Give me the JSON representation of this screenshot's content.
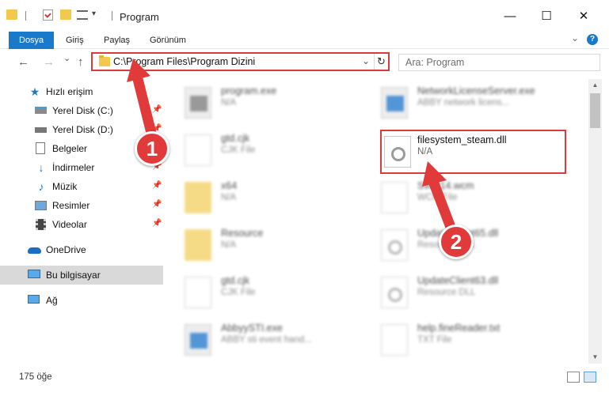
{
  "window": {
    "title": "Program",
    "minimize_glyph": "—",
    "maximize_glyph": "☐",
    "close_glyph": "✕"
  },
  "ribbon": {
    "tabs": [
      {
        "label": "Dosya"
      },
      {
        "label": "Giriş"
      },
      {
        "label": "Paylaş"
      },
      {
        "label": "Görünüm"
      }
    ],
    "expand_glyph": "⌄",
    "help_glyph": "?"
  },
  "navigation": {
    "back_glyph": "←",
    "forward_glyph": "→",
    "recent_glyph": "⌄",
    "up_glyph": "↑",
    "address": "C:\\Program Files\\Program Dizini",
    "address_chevron": "⌄",
    "refresh_glyph": "↻",
    "search_placeholder": "Ara: Program"
  },
  "sidebar": {
    "items": [
      {
        "label": "Hızlı erişim",
        "icon": "star-icon",
        "pinned": false
      },
      {
        "label": "Yerel Disk (C:)",
        "icon": "drive-icon",
        "pinned": true
      },
      {
        "label": "Yerel Disk (D:)",
        "icon": "drive-icon",
        "pinned": true
      },
      {
        "label": "Belgeler",
        "icon": "documents-icon",
        "pinned": true
      },
      {
        "label": "İndirmeler",
        "icon": "download-icon",
        "pinned": true
      },
      {
        "label": "Müzik",
        "icon": "music-icon",
        "pinned": true
      },
      {
        "label": "Resimler",
        "icon": "pictures-icon",
        "pinned": true
      },
      {
        "label": "Videolar",
        "icon": "video-icon",
        "pinned": true
      },
      {
        "label": "OneDrive",
        "icon": "cloud-icon",
        "pinned": false
      },
      {
        "label": "Bu bilgisayar",
        "icon": "computer-icon",
        "pinned": false,
        "selected": true
      },
      {
        "label": "Ağ",
        "icon": "network-icon",
        "pinned": false
      }
    ]
  },
  "files": {
    "left": [
      {
        "name": "program.exe",
        "type": "N/A",
        "icon": "exe-icon"
      },
      {
        "name": "gtd.cjk",
        "type": "CJK File",
        "icon": "document-icon"
      },
      {
        "name": "x64",
        "type": "N/A",
        "icon": "folder-icon"
      },
      {
        "name": "Resource",
        "type": "N/A",
        "icon": "folder-icon"
      },
      {
        "name": "gtd.cjk",
        "type": "CJK File",
        "icon": "document-icon"
      },
      {
        "name": "AbbyySTI.exe",
        "type": "ABBY sti event hand...",
        "icon": "exe-icon"
      }
    ],
    "right": [
      {
        "name": "NetworkLicenseServer.exe",
        "type": "ABBY network licens...",
        "icon": "exe-icon"
      },
      {
        "name": "filesystem_steam.dll",
        "type": "N/A",
        "icon": "gear-file-icon",
        "highlighted": true
      },
      {
        "name": "SWP14.wcm",
        "type": "WCM File",
        "icon": "document-icon"
      },
      {
        "name": "UpdateClient65.dll",
        "type": "Resource DLL",
        "icon": "gear-file-icon"
      },
      {
        "name": "UpdateClient63.dll",
        "type": "Resource DLL",
        "icon": "gear-file-icon"
      },
      {
        "name": "help.fineReader.txt",
        "type": "TXT File",
        "icon": "document-icon"
      }
    ]
  },
  "status": {
    "item_count": "175 öğe"
  },
  "annotations": {
    "step1": "1",
    "step2": "2",
    "color": "#e03a3a"
  }
}
